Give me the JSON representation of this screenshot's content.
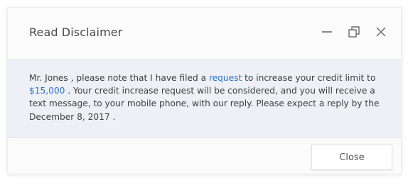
{
  "dialog": {
    "title": "Read Disclaimer",
    "controls": {
      "minimize_icon": "minimize-icon",
      "restore_icon": "restore-icon",
      "close_icon": "close-icon"
    },
    "message": {
      "part1": "Mr. Jones , please note that I have filed a ",
      "link_request": "request",
      "part2": " to increase your credit limit to ",
      "link_amount": "$15,000",
      "part3": " . Your credit increase request will be considered, and you will receive a text message, to your mobile phone, with our reply. Please expect a reply by the December 8, 2017 ."
    },
    "footer": {
      "close_label": "Close"
    }
  },
  "colors": {
    "link": "#2a74c8",
    "body_bg": "#eef0f5",
    "text": "#3d3d3d"
  }
}
